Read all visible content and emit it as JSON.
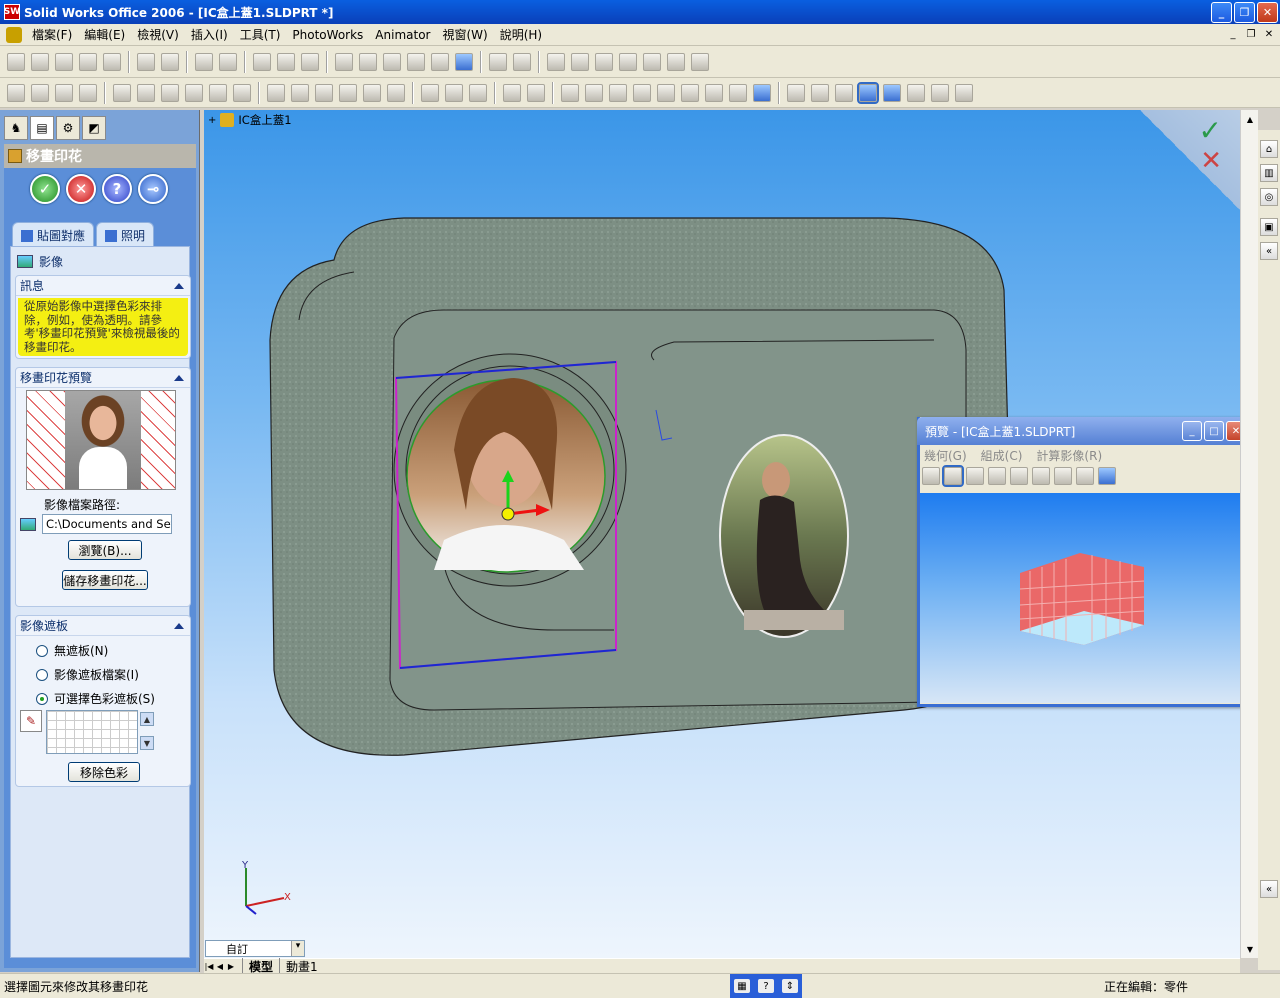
{
  "window": {
    "app_icon": "SW",
    "title": "Solid Works Office 2006 - [IC盒上蓋1.SLDPRT *]",
    "controls": [
      "_",
      "❐",
      "✕"
    ]
  },
  "menu": {
    "items": [
      "檔案(F)",
      "編輯(E)",
      "檢視(V)",
      "插入(I)",
      "工具(T)",
      "PhotoWorks",
      "Animator",
      "視窗(W)",
      "說明(H)"
    ],
    "mdi_controls": [
      "_",
      "❐",
      "✕"
    ]
  },
  "property_manager": {
    "title": "移畫印花",
    "buttons": {
      "ok": "✓",
      "cancel": "✕",
      "help": "?",
      "pin": "⊸"
    },
    "tabs": [
      "貼圖對應",
      "照明"
    ],
    "active_section": "影像",
    "message": {
      "header": "訊息",
      "text": "從原始影像中選擇色彩來排除，例如，使為透明。請參考'移畫印花預覽'來檢視最後的移畫印花。"
    },
    "preview": {
      "header": "移畫印花預覽",
      "path_label": "影像檔案路徑:",
      "path_value": "C:\\Documents and Settings",
      "browse_button": "瀏覽(B)...",
      "save_button": "儲存移畫印花..."
    },
    "mask": {
      "header": "影像遮板",
      "options": [
        "無遮板(N)",
        "影像遮板檔案(I)",
        "可選擇色彩遮板(S)"
      ],
      "selected_index": 2,
      "remove_color_button": "移除色彩"
    }
  },
  "viewport": {
    "tree_root": "IC盒上蓋1",
    "triad": {
      "y": "Y",
      "x": "X"
    },
    "confirm_ok": "✓",
    "confirm_cancel": "✕"
  },
  "preview_window": {
    "title": "預覽 - [IC盒上蓋1.SLDPRT]",
    "menu": [
      "幾何(G)",
      "組成(C)",
      "計算影像(R)"
    ]
  },
  "bottom": {
    "config": "自訂",
    "tabs": [
      "模型",
      "動畫1"
    ]
  },
  "status": {
    "left": "選擇圖元來修改其移畫印花",
    "right": "正在編輯：零件",
    "icons": [
      "▦",
      "?",
      "⇕"
    ]
  }
}
